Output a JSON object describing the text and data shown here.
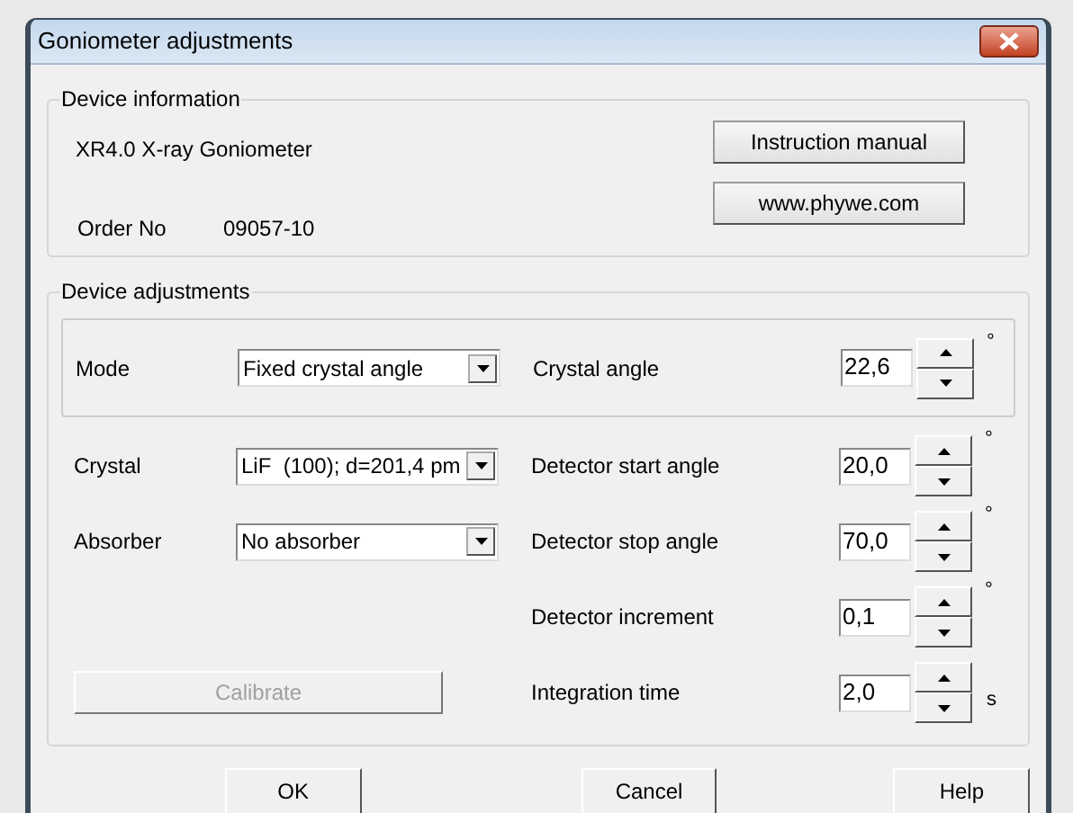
{
  "window": {
    "title": "Goniometer adjustments"
  },
  "device_information": {
    "title": "Device information",
    "device": "XR4.0 X-ray Goniometer",
    "order_label": "Order No",
    "order_number": "09057-10",
    "buttons": [
      "Instruction manual",
      "www.phywe.com"
    ]
  },
  "device_adjustments": {
    "title": "Device adjustments",
    "selects": [
      {
        "label": "Mode",
        "value": "Fixed crystal angle"
      },
      {
        "label": "Crystal",
        "value": "LiF  (100); d=201,4 pm"
      },
      {
        "label": "Absorber",
        "value": "No absorber"
      }
    ],
    "spinners": [
      {
        "label": "Crystal angle",
        "value": "22,6",
        "unit": "°"
      },
      {
        "label": "Detector start angle",
        "value": "20,0",
        "unit": "°"
      },
      {
        "label": "Detector stop angle",
        "value": "70,0",
        "unit": "°"
      },
      {
        "label": "Detector increment",
        "value": "0,1",
        "unit": "°"
      },
      {
        "label": "Integration time",
        "value": "2,0",
        "unit": "s"
      }
    ],
    "calibrate": {
      "label": "Calibrate",
      "disabled": true
    }
  },
  "buttons": [
    "OK",
    "Cancel",
    "Help"
  ]
}
